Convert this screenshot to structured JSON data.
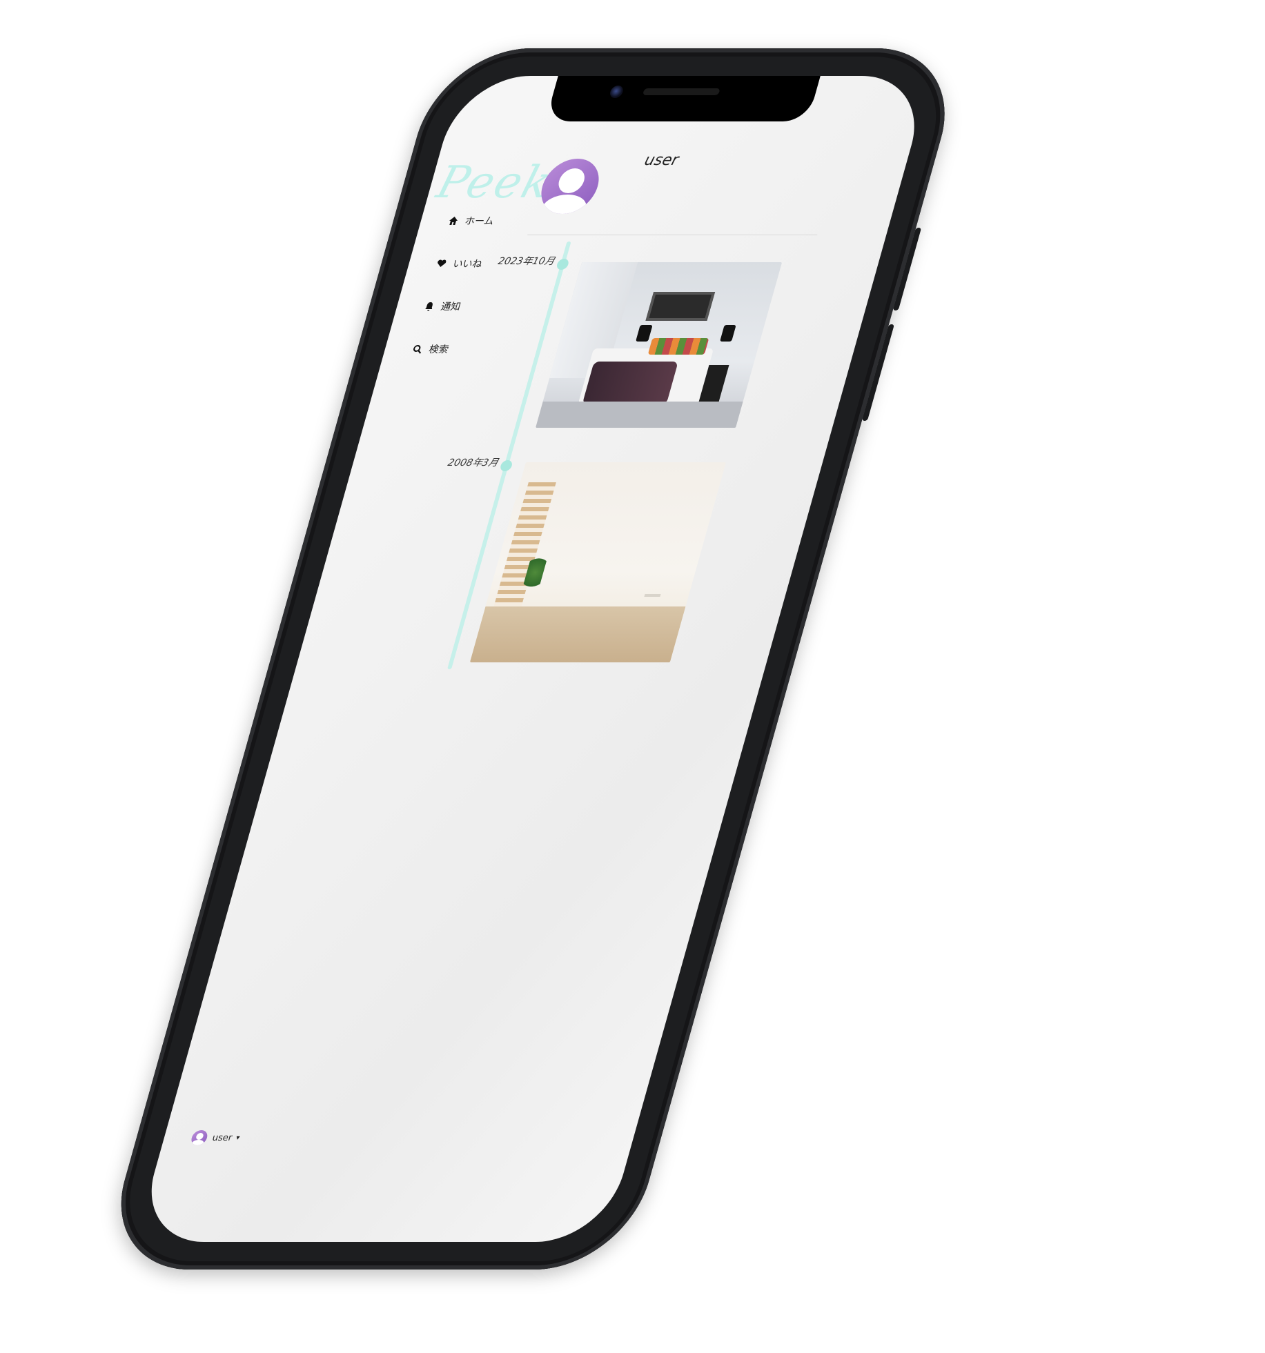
{
  "app": {
    "logo_text": "Peek",
    "header_username": "user"
  },
  "nav": {
    "items": [
      {
        "label": "ホーム",
        "icon": "home-icon"
      },
      {
        "label": "いいね",
        "icon": "heart-icon"
      },
      {
        "label": "通知",
        "icon": "bell-icon"
      },
      {
        "label": "検索",
        "icon": "search-icon"
      }
    ]
  },
  "timeline": {
    "entries": [
      {
        "date": "2023年10月",
        "image": "bedroom-photo"
      },
      {
        "date": "2008年3月",
        "image": "empty-room-photo"
      }
    ]
  },
  "footer": {
    "username": "user",
    "caret": "▾"
  },
  "colors": {
    "logo": "#bff0ea",
    "timeline": "#c6f0ea",
    "avatar": "#a070cc"
  }
}
